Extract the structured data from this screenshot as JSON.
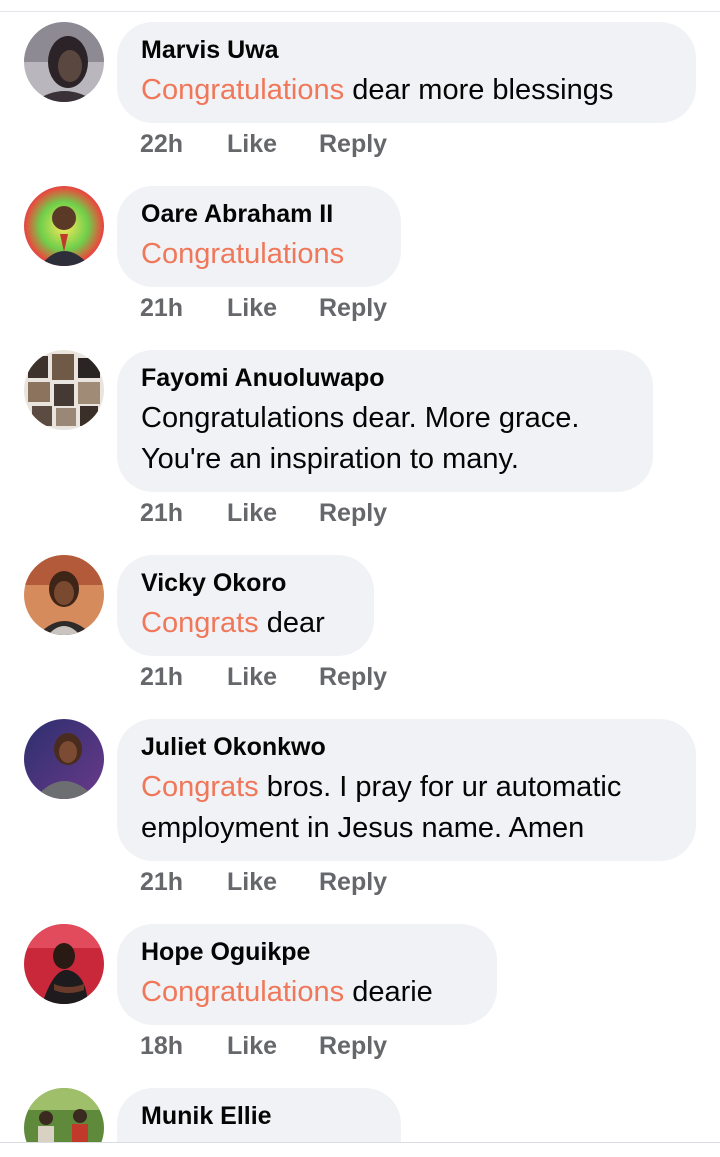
{
  "colors": {
    "bubble": "#f0f2f5",
    "highlight": "#f07759",
    "meta": "#65676b",
    "text": "#050505"
  },
  "comments": [
    {
      "author": "Marvis Uwa",
      "highlight": "Congratulations",
      "text": " dear more blessings",
      "time": "22h",
      "like": "Like",
      "reply": "Reply"
    },
    {
      "author": "Oare Abraham II",
      "highlight": "Congratulations",
      "text": "",
      "time": "21h",
      "like": "Like",
      "reply": "Reply"
    },
    {
      "author": "Fayomi Anuoluwapo",
      "highlight": "",
      "text": "Congratulations dear. More grace. You're an inspiration to many.",
      "time": "21h",
      "like": "Like",
      "reply": "Reply"
    },
    {
      "author": "Vicky Okoro",
      "highlight": "Congrats",
      "text": " dear",
      "time": "21h",
      "like": "Like",
      "reply": "Reply"
    },
    {
      "author": "Juliet Okonkwo",
      "highlight": "Congrats",
      "text": " bros. I pray for ur automatic employment in Jesus name. Amen",
      "time": "21h",
      "like": "Like",
      "reply": "Reply"
    },
    {
      "author": "Hope Oguikpe",
      "highlight": "Congratulations",
      "text": " dearie",
      "time": "18h",
      "like": "Like",
      "reply": "Reply"
    },
    {
      "author": "Munik Ellie"
    }
  ]
}
